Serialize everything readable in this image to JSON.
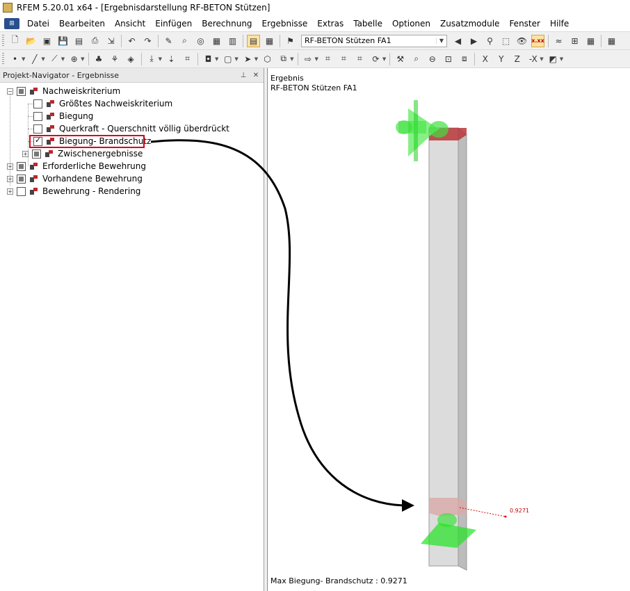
{
  "window": {
    "title": "RFEM 5.20.01 x64 - [Ergebnisdarstellung RF-BETON Stützen]"
  },
  "menu": [
    {
      "label": "Datei"
    },
    {
      "label": "Bearbeiten"
    },
    {
      "label": "Ansicht"
    },
    {
      "label": "Einfügen"
    },
    {
      "label": "Berechnung"
    },
    {
      "label": "Ergebnisse"
    },
    {
      "label": "Extras"
    },
    {
      "label": "Tabelle"
    },
    {
      "label": "Optionen"
    },
    {
      "label": "Zusatzmodule"
    },
    {
      "label": "Fenster"
    },
    {
      "label": "Hilfe"
    }
  ],
  "toolbar": {
    "case_select": "RF-BETON Stützen FA1",
    "toggle_label": "x.xx"
  },
  "navigator": {
    "title": "Projekt-Navigator - Ergebnisse",
    "items": [
      {
        "label": "Nachweiskriterium"
      },
      {
        "label": "Größtes Nachweiskriterium"
      },
      {
        "label": "Biegung"
      },
      {
        "label": "Querkraft - Querschnitt völlig überdrückt"
      },
      {
        "label": "Biegung- Brandschutz"
      },
      {
        "label": "Zwischenergebnisse"
      },
      {
        "label": "Erforderliche Bewehrung"
      },
      {
        "label": "Vorhandene Bewehrung"
      },
      {
        "label": "Bewehrung - Rendering"
      }
    ]
  },
  "viewport": {
    "title_line1": "Ergebnis",
    "title_line2": "RF-BETON Stützen FA1",
    "max_value": "0.9271",
    "footer": "Max Biegung- Brandschutz : 0.9271"
  },
  "colors": {
    "highlight": "#d7000f",
    "support": "#20e020",
    "top_face": "#c0282c",
    "value_line": "#e00000"
  }
}
